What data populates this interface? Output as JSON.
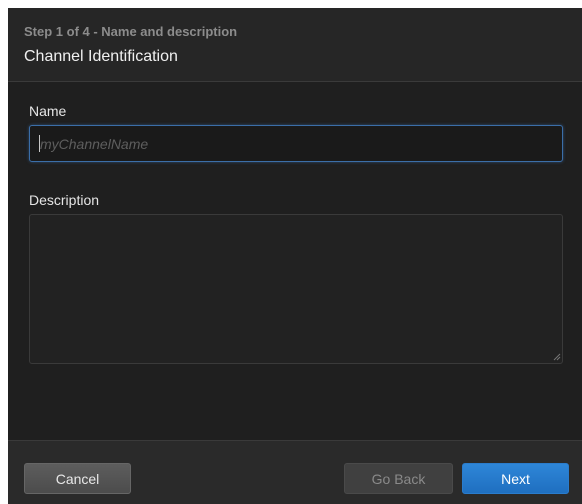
{
  "header": {
    "step": "Step 1 of 4 - Name and description",
    "title": "Channel Identification"
  },
  "form": {
    "name_label": "Name",
    "name_placeholder": "myChannelName",
    "name_value": "",
    "description_label": "Description",
    "description_value": ""
  },
  "footer": {
    "cancel_label": "Cancel",
    "back_label": "Go Back",
    "next_label": "Next"
  },
  "colors": {
    "dialog_bg": "#1f1f1f",
    "input_focus_border": "#3b6ea8",
    "primary_button": "#2e86d8"
  }
}
